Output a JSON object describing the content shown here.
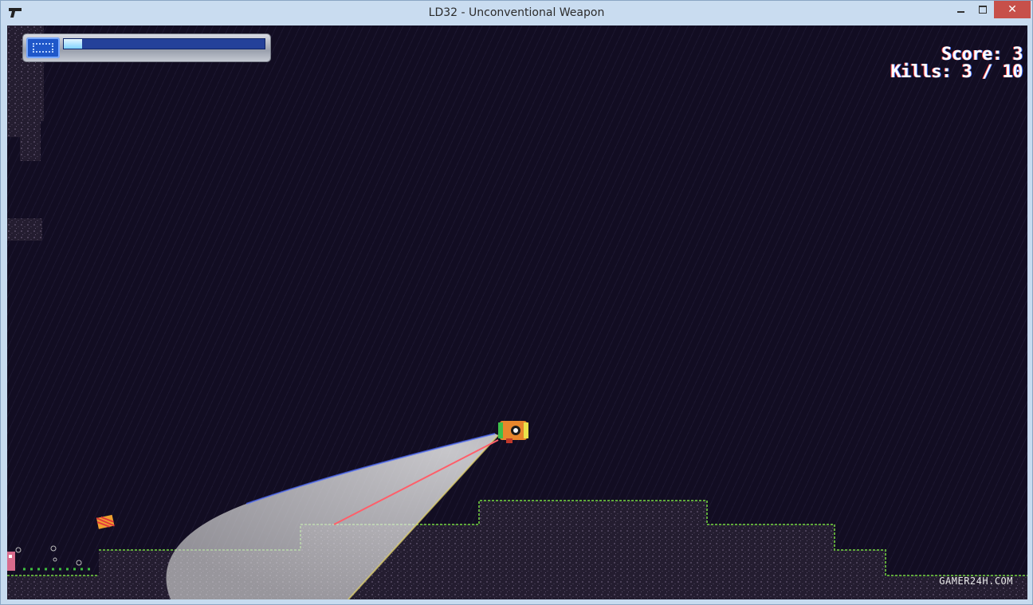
{
  "window": {
    "title": "LD32 - Unconventional Weapon",
    "minimize_icon": "minimize-icon",
    "maximize_icon": "maximize-icon",
    "close_icon": "close-icon",
    "close_glyph": "✕",
    "app_icon": "pistol-icon"
  },
  "hud": {
    "health_fraction": 0.09,
    "score_text": "Score: 3",
    "kills_text": "Kills: 3 / 10"
  },
  "watermark": "GAMER24H.COM",
  "colors": {
    "sky": "#120d22",
    "ground": "#2a2336",
    "grass": "#5fa83a",
    "beam": "#d9d9d9",
    "laser": "#ff5f6a",
    "close_button": "#c7504a"
  }
}
